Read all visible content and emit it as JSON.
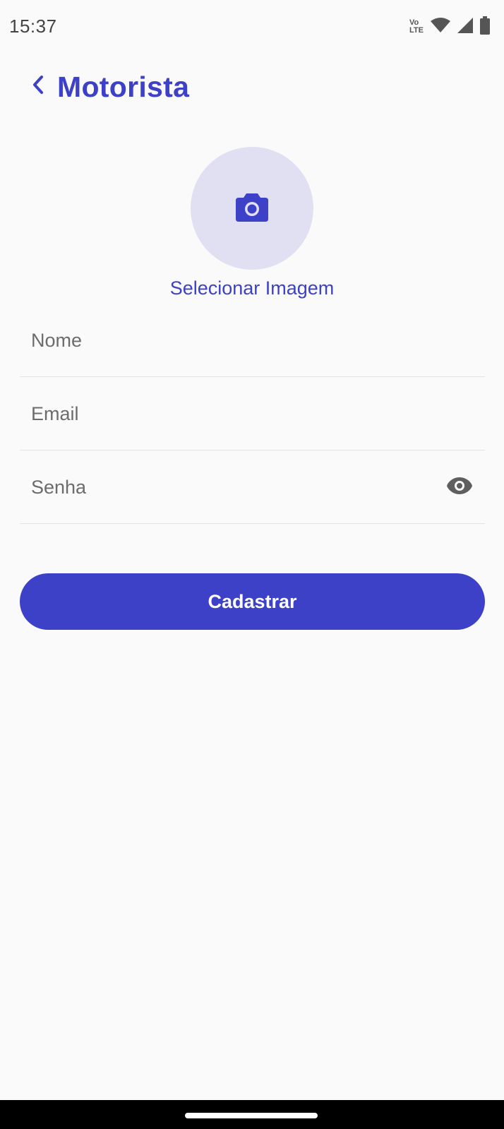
{
  "status_bar": {
    "time": "15:37",
    "volte_top": "Vo",
    "volte_bottom": "LTE",
    "icons": [
      "volte-icon",
      "wifi-icon",
      "signal-icon",
      "battery-icon"
    ]
  },
  "header": {
    "title": "Motorista",
    "back_icon": "chevron-left-icon"
  },
  "avatar": {
    "icon": "camera-icon",
    "label": "Selecionar Imagem"
  },
  "form": {
    "name": {
      "placeholder": "Nome",
      "value": ""
    },
    "email": {
      "placeholder": "Email",
      "value": ""
    },
    "password": {
      "placeholder": "Senha",
      "value": "",
      "toggle_icon": "eye-icon"
    },
    "submit_label": "Cadastrar"
  },
  "colors": {
    "accent": "#3d41c7",
    "avatar_bg": "#e1e0f3",
    "background": "#fafafa",
    "divider": "#e3e3e3"
  }
}
